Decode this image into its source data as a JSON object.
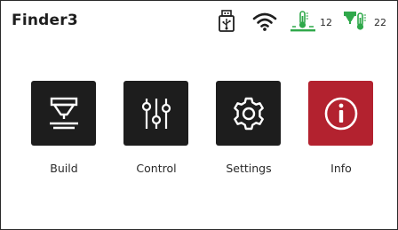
{
  "header": {
    "device_name": "Finder3",
    "bed_temp": "12",
    "nozzle_temp": "22"
  },
  "status_icons": [
    "usb-icon",
    "wifi-icon",
    "bed-temperature-icon",
    "nozzle-temperature-icon"
  ],
  "menu": {
    "build_label": "Build",
    "control_label": "Control",
    "settings_label": "Settings",
    "info_label": "Info"
  },
  "colors": {
    "tile_dark": "#1d1d1d",
    "info_red": "#b3222f",
    "temp_green": "#2fa84a"
  }
}
